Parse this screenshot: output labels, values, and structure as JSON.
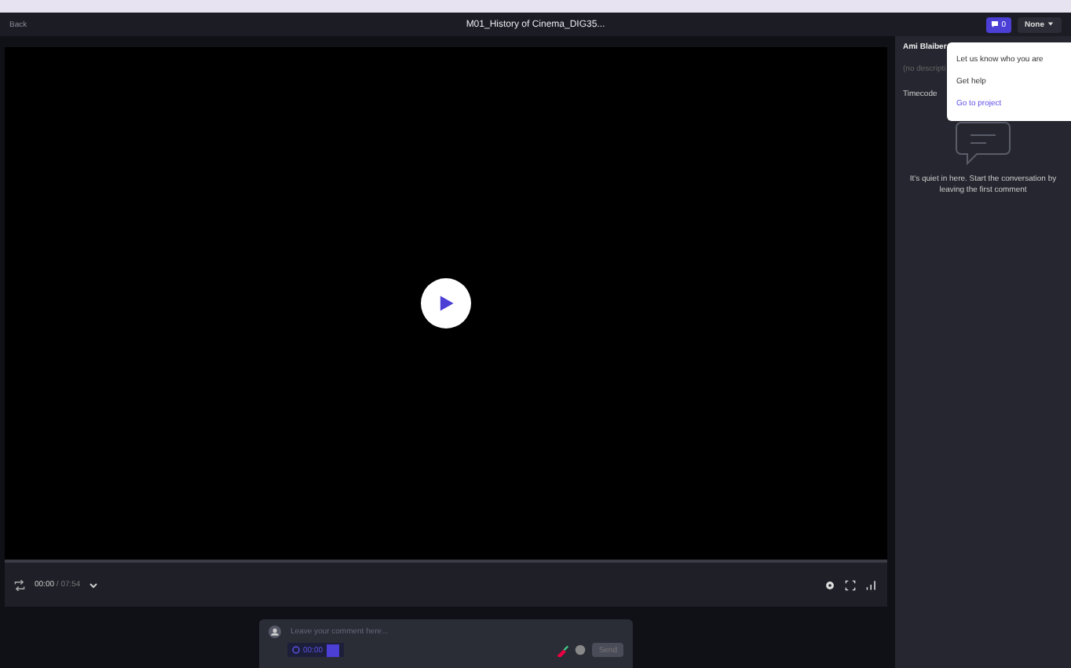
{
  "header": {
    "back": "Back",
    "title": "M01_History of Cinema_DIG35...",
    "comment_count": "0",
    "status": "None"
  },
  "player": {
    "current_time": "00:00",
    "separator": "/",
    "duration": "07:54"
  },
  "comment_box": {
    "placeholder": "Leave your comment here...",
    "timecode": "00:00",
    "timecode_checked": true,
    "send": "Send",
    "send_disabled": true
  },
  "sidebar": {
    "name": "Ami Blaiber",
    "description": "(no descripti",
    "sort": "Timecode",
    "empty_message": "It's quiet in here. Start the conversation by leaving the first comment"
  },
  "menu": {
    "items": [
      {
        "label": "Let us know who you are",
        "kind": "plain"
      },
      {
        "label": "Get help",
        "kind": "plain"
      },
      {
        "label": "Go to project",
        "kind": "link"
      }
    ]
  }
}
